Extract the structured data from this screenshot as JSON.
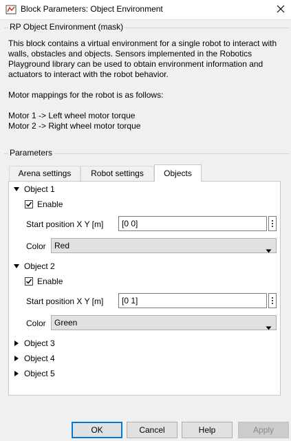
{
  "window": {
    "title": "Block Parameters: Object Environment",
    "close_glyph": "✕"
  },
  "description": {
    "group_label": "RP Object Environment (mask)",
    "paragraph1": "This block contains a virtual environment for a single robot to interact with walls, obstacles and objects. Sensors implemented in the Robotics Playground library can be used to obtain environment information and actuators to interact with the robot behavior.",
    "paragraph2": "Motor mappings for the robot is as follows:",
    "line_motor1": "Motor 1 -> Left wheel motor torque",
    "line_motor2": "Motor 2 -> Right wheel motor torque"
  },
  "parameters": {
    "group_label": "Parameters",
    "tabs": [
      {
        "label": "Arena settings",
        "active": false
      },
      {
        "label": "Robot settings",
        "active": false
      },
      {
        "label": "Objects",
        "active": true
      }
    ],
    "objects": [
      {
        "label": "Object 1",
        "expanded": true,
        "enable_label": "Enable",
        "enabled": true,
        "start_label": "Start position X Y [m]",
        "start_value": "[0 0]",
        "color_label": "Color",
        "color_value": "Red"
      },
      {
        "label": "Object 2",
        "expanded": true,
        "enable_label": "Enable",
        "enabled": true,
        "start_label": "Start position X Y [m]",
        "start_value": "[0 1]",
        "color_label": "Color",
        "color_value": "Green"
      },
      {
        "label": "Object 3",
        "expanded": false
      },
      {
        "label": "Object 4",
        "expanded": false
      },
      {
        "label": "Object 5",
        "expanded": false
      }
    ]
  },
  "buttons": {
    "ok": "OK",
    "cancel": "Cancel",
    "help": "Help",
    "apply": "Apply"
  },
  "icons": {
    "app": "simulink-block-icon",
    "expanded": "triangle-down-icon",
    "collapsed": "triangle-right-icon",
    "checkbox": "checkmark-icon",
    "more": "vertical-ellipsis-icon",
    "dropdown": "chevron-down-icon"
  },
  "colors": {
    "accent": "#0078d7",
    "panel_bg": "#ffffff",
    "window_bg": "#f0f0f0"
  }
}
